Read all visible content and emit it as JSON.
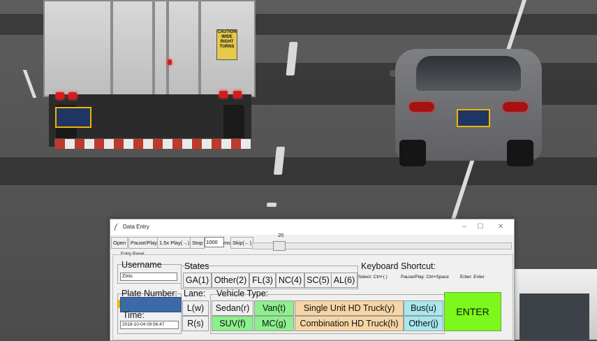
{
  "window": {
    "title": "Data Entry",
    "controls": {
      "minimize": "–",
      "maximize": "☐",
      "close": "✕"
    }
  },
  "toolbar": {
    "open": "Open",
    "pause_play": "Pause/Play",
    "play_fast": "1.5x Play(→)",
    "stop": "Stop",
    "interval_value": "1000",
    "interval_unit": "ms",
    "skip": "Skip(←)",
    "scale_value": "20"
  },
  "panel": {
    "label": "Entry Panel",
    "username_label": "Username",
    "username_value": "Zixiu",
    "states_label": "States",
    "states": [
      "GA(1)",
      "Other(2)",
      "FL(3)",
      "NC(4)",
      "SC(5)",
      "AL(6)"
    ],
    "keyboard": {
      "title": "Keyboard Shortcut:",
      "select": "Select: Ctrl+( )",
      "pause": "Pause/Play: Ctrl+Space",
      "enter": "Enter: Enter"
    },
    "plate_label": "Plate Number:",
    "time_label": "Time:",
    "time_value": "2018-10-04 09:56:47",
    "lane_label": "Lane:",
    "lanes": [
      "L(w)",
      "R(s)"
    ],
    "vehicle_label": "Vehicle Type:",
    "vehicles_row1": [
      "Sedan(r)",
      "Van(t)",
      "Single Unit HD Truck(y)",
      "Bus(u)"
    ],
    "vehicles_row2": [
      "SUV(f)",
      "MC(g)",
      "Combination HD Truck(h)",
      "Other(j)"
    ],
    "enter": "ENTER"
  },
  "scene": {
    "caution_sign": "CAUTION WIDE RIGHT TURNS"
  },
  "colors": {
    "enter_green": "#7cf81c",
    "vehicle_green": "#8cf08c",
    "vehicle_peach": "#f7d6a6",
    "vehicle_cyan": "#a8e7ee",
    "plate_highlight": "#f0b400"
  }
}
